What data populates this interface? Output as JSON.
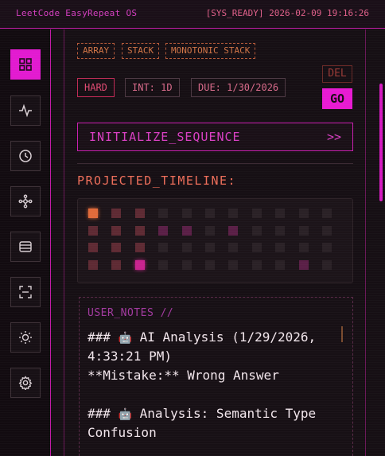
{
  "app": {
    "title": "LeetCode EasyRepeat OS",
    "status": "[SYS_READY] 2026-02-09 19:16:26"
  },
  "sidebar": {
    "items": [
      {
        "icon": "grid-icon",
        "active": true
      },
      {
        "icon": "activity-icon",
        "active": false
      },
      {
        "icon": "clock-icon",
        "active": false
      },
      {
        "icon": "network-icon",
        "active": false
      },
      {
        "icon": "database-icon",
        "active": false
      },
      {
        "icon": "scan-icon",
        "active": false
      },
      {
        "icon": "sun-icon",
        "active": false
      },
      {
        "icon": "gear-icon",
        "active": false
      }
    ]
  },
  "problem": {
    "tags": [
      "ARRAY",
      "STACK",
      "MONOTONIC STACK"
    ],
    "difficulty": "HARD",
    "interval": "INT: 1D",
    "due": "DUE: 1/30/2026"
  },
  "actions": {
    "delete_label": "DEL",
    "go_label": "GO",
    "initialize_label": "INITIALIZE_SEQUENCE",
    "initialize_arrow": ">>"
  },
  "timeline": {
    "title": "PROJECTED_TIMELINE:",
    "rows": 4,
    "cols": 11,
    "colors": {
      "empty": "#2a2126",
      "dim": "#4a2330",
      "mid": "#5e2a33",
      "magenta_dim": "#5a1f46",
      "accent_orange": "#e06a3a",
      "accent_magenta": "#c8238e"
    },
    "cells": [
      [
        "accent_orange",
        "mid",
        "mid",
        "empty",
        "empty",
        "empty",
        "empty",
        "empty",
        "empty",
        "empty",
        "empty"
      ],
      [
        "mid",
        "mid",
        "mid",
        "magenta_dim",
        "magenta_dim",
        "empty",
        "magenta_dim",
        "empty",
        "empty",
        "empty",
        "empty"
      ],
      [
        "mid",
        "mid",
        "mid",
        "empty",
        "empty",
        "empty",
        "empty",
        "empty",
        "empty",
        "empty",
        "empty"
      ],
      [
        "mid",
        "mid",
        "accent_magenta",
        "empty",
        "empty",
        "empty",
        "empty",
        "empty",
        "empty",
        "magenta_dim",
        "empty"
      ]
    ]
  },
  "notes": {
    "heading": "USER_NOTES //",
    "lines": [
      {
        "prefix": "### ",
        "emoji": "🤖",
        "text": " AI Analysis (1/29/2026,"
      },
      {
        "prefix": "",
        "emoji": "",
        "text": "4:33:21 PM)"
      },
      {
        "prefix": "",
        "emoji": "",
        "text": "**Mistake:** Wrong Answer"
      },
      {
        "prefix": "",
        "emoji": "",
        "text": ""
      },
      {
        "prefix": "### ",
        "emoji": "🤖",
        "text": " Analysis: Semantic Type"
      },
      {
        "prefix": "",
        "emoji": "",
        "text": "Confusion"
      }
    ]
  }
}
